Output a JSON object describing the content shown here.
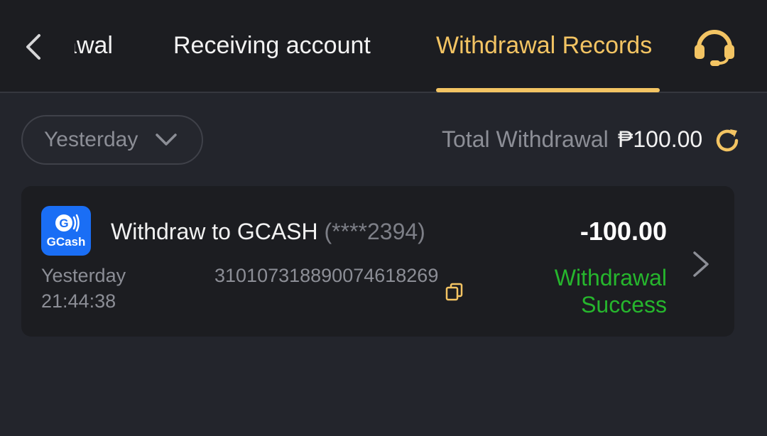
{
  "header": {
    "tabs": [
      {
        "label": "Withdrawal",
        "active": false
      },
      {
        "label": "Receiving account",
        "active": false
      },
      {
        "label": "Withdrawal Records",
        "active": true
      }
    ],
    "back_icon": "chevron-left-icon",
    "support_icon": "headset-icon"
  },
  "filter": {
    "selected_period": "Yesterday",
    "dropdown_icon": "chevron-down-icon"
  },
  "summary": {
    "total_label": "Total Withdrawal",
    "total_value": "₱100.00",
    "refresh_icon": "refresh-icon"
  },
  "records": [
    {
      "method_logo_text": "GCash",
      "title": "Withdraw to GCASH",
      "masked_account": "(****2394)",
      "amount": "-100.00",
      "date": "Yesterday",
      "time": "21:44:38",
      "order_id": "3101073188900746182​69",
      "status": "Withdrawal Success"
    }
  ],
  "colors": {
    "accent": "#f3c463",
    "success": "#26b62d",
    "gcash_blue": "#1a6ef5",
    "background": "#23252c",
    "header_bg": "#1c1d21"
  }
}
